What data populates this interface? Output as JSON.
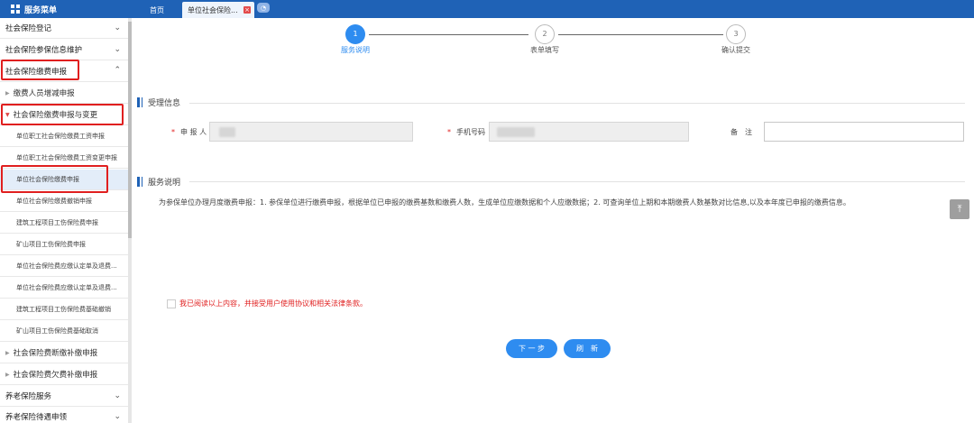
{
  "header": {
    "menu_title": "服务菜单",
    "tabs": [
      {
        "label": "首页"
      },
      {
        "label": "单位社会保险..."
      }
    ]
  },
  "sidebar": {
    "items": [
      {
        "label": "社会保险登记"
      },
      {
        "label": "社会保险参保信息维护"
      },
      {
        "label": "社会保险缴费申报"
      },
      {
        "label": "缴费人员增减申报"
      },
      {
        "label": "社会保险缴费申报与变更"
      },
      {
        "label": "单位职工社会保险缴费工资申报"
      },
      {
        "label": "单位职工社会保险缴费工资变更申报"
      },
      {
        "label": "单位社会保险缴费申报"
      },
      {
        "label": "单位社会保险缴费撤销申报"
      },
      {
        "label": "建筑工程项目工伤保险费申报"
      },
      {
        "label": "矿山项目工伤保险费申报"
      },
      {
        "label": "单位社会保险费应缴认定单及退费..."
      },
      {
        "label": "单位社会保险费应缴认定单及退费..."
      },
      {
        "label": "建筑工程项目工伤保险费基础撤销"
      },
      {
        "label": "矿山项目工伤保险费基础取消"
      },
      {
        "label": "社会保险费断缴补缴申报"
      },
      {
        "label": "社会保险费欠费补缴申报"
      },
      {
        "label": "养老保险服务"
      },
      {
        "label": "养老保险待遇申领"
      }
    ]
  },
  "steps": [
    {
      "num": "1",
      "label": "服务说明"
    },
    {
      "num": "2",
      "label": "表单填写"
    },
    {
      "num": "3",
      "label": "确认提交"
    }
  ],
  "section1": {
    "title": "受理信息",
    "applicant_label": "申 报 人",
    "phone_label": "手机号码",
    "remark_label": "备　注"
  },
  "section2": {
    "title": "服务说明",
    "description": "为参保单位办理月度缴费申报：1. 参保单位进行缴费申报，根据单位已申报的缴费基数和缴费人数，生成单位应缴数据和个人应缴数据；2. 可查询单位上期和本期缴费人数基数对比信息,以及本年度已申报的缴费信息。"
  },
  "agreement": "我已阅读以上内容，并接受用户使用协议和相关法律条款。",
  "buttons": {
    "next": "下 一 步",
    "refresh": "刷　新"
  },
  "colors": {
    "primary": "#2e8cf0",
    "topbar": "#1f62b6",
    "highlight": "#e01f1f"
  }
}
